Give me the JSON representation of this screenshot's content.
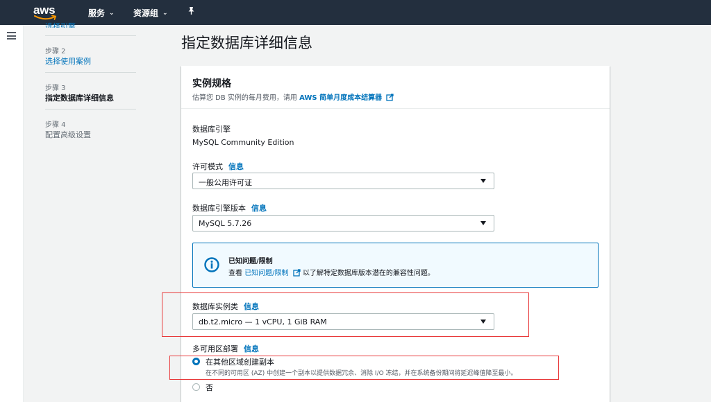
{
  "nav": {
    "logo": "aws",
    "services": "服务",
    "resource_groups": "资源组",
    "pin_icon": "pin-icon"
  },
  "steps": {
    "step1_partial": "选择引擎",
    "step2_num": "步骤 2",
    "step2_label": "选择使用案例",
    "step3_num": "步骤 3",
    "step3_label": "指定数据库详细信息",
    "step4_num": "步骤 4",
    "step4_label": "配置高级设置"
  },
  "page_title": "指定数据库详细信息",
  "instance_spec": {
    "title": "实例规格",
    "desc_prefix": "估算您 DB 实例的每月费用，请用",
    "desc_link": "AWS 简单月度成本结算器",
    "engine_label": "数据库引擎",
    "engine_value": "MySQL Community Edition",
    "license_label": "许可模式",
    "license_value": "一般公用许可证",
    "version_label": "数据库引擎版本",
    "version_value": "MySQL 5.7.26",
    "info": "信息",
    "alert_title": "已知问题/限制",
    "alert_prefix": "查看",
    "alert_link": "已知问题/限制",
    "alert_suffix": "以了解特定数据库版本潜在的兼容性问题。",
    "instance_class_label": "数据库实例类",
    "instance_class_value": "db.t2.micro — 1 vCPU, 1 GiB RAM",
    "multi_az_label": "多可用区部署",
    "multi_az_yes": "在其他区域创建副本",
    "multi_az_yes_desc": "在不同的可用区 (AZ) 中创建一个副本以提供数据冗余、消除 I/O 冻结，并在系统备份期间将延迟峰值降至最小。",
    "multi_az_no": "否"
  },
  "colors": {
    "nav_bg": "#232f3e",
    "link": "#0073bb",
    "highlight": "#e8393a",
    "alert_bg": "#f1faff"
  }
}
